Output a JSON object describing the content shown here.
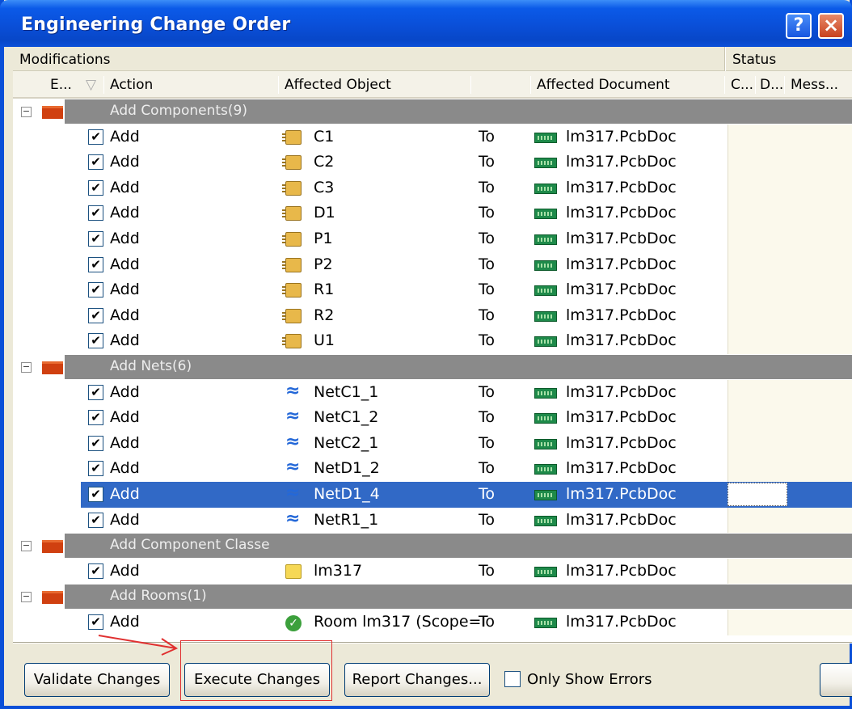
{
  "window": {
    "title": "Engineering Change Order",
    "help_glyph": "?",
    "close_glyph": "×"
  },
  "header_groups": {
    "modifications": "Modifications",
    "status": "Status"
  },
  "columns": {
    "enable": "E...",
    "action": "Action",
    "affected_object": "Affected Object",
    "affected_document": "Affected Document",
    "check": "C...",
    "done": "D...",
    "message": "Mess..."
  },
  "groups": [
    {
      "label": "Add Components(9)",
      "expander": "−",
      "items": [
        {
          "action": "Add",
          "object": "C1",
          "to": "To",
          "document": "lm317.PcbDoc"
        },
        {
          "action": "Add",
          "object": "C2",
          "to": "To",
          "document": "lm317.PcbDoc"
        },
        {
          "action": "Add",
          "object": "C3",
          "to": "To",
          "document": "lm317.PcbDoc"
        },
        {
          "action": "Add",
          "object": "D1",
          "to": "To",
          "document": "lm317.PcbDoc"
        },
        {
          "action": "Add",
          "object": "P1",
          "to": "To",
          "document": "lm317.PcbDoc"
        },
        {
          "action": "Add",
          "object": "P2",
          "to": "To",
          "document": "lm317.PcbDoc"
        },
        {
          "action": "Add",
          "object": "R1",
          "to": "To",
          "document": "lm317.PcbDoc"
        },
        {
          "action": "Add",
          "object": "R2",
          "to": "To",
          "document": "lm317.PcbDoc"
        },
        {
          "action": "Add",
          "object": "U1",
          "to": "To",
          "document": "lm317.PcbDoc"
        }
      ]
    },
    {
      "label": "Add Nets(6)",
      "expander": "−",
      "items": [
        {
          "action": "Add",
          "object": "NetC1_1",
          "to": "To",
          "document": "lm317.PcbDoc"
        },
        {
          "action": "Add",
          "object": "NetC1_2",
          "to": "To",
          "document": "lm317.PcbDoc"
        },
        {
          "action": "Add",
          "object": "NetC2_1",
          "to": "To",
          "document": "lm317.PcbDoc"
        },
        {
          "action": "Add",
          "object": "NetD1_2",
          "to": "To",
          "document": "lm317.PcbDoc"
        },
        {
          "action": "Add",
          "object": "NetD1_4",
          "to": "To",
          "document": "lm317.PcbDoc"
        },
        {
          "action": "Add",
          "object": "NetR1_1",
          "to": "To",
          "document": "lm317.PcbDoc"
        }
      ]
    },
    {
      "label": "Add Component Classe",
      "expander": "−",
      "items": [
        {
          "action": "Add",
          "object": "lm317",
          "to": "To",
          "document": "lm317.PcbDoc"
        }
      ]
    },
    {
      "label": "Add Rooms(1)",
      "expander": "−",
      "items": [
        {
          "action": "Add",
          "object": "Room lm317 (Scope=I",
          "to": "To",
          "document": "lm317.PcbDoc"
        }
      ]
    }
  ],
  "checkbox_glyph": "✔",
  "footer": {
    "validate": "Validate Changes",
    "execute": "Execute Changes",
    "report": "Report Changes...",
    "only_show_errors": "Only Show Errors"
  },
  "colors": {
    "title_bar": "#0A4FD8",
    "selection": "#3169C6",
    "group_band": "#8A8A8A",
    "annotation": "#E03030"
  }
}
